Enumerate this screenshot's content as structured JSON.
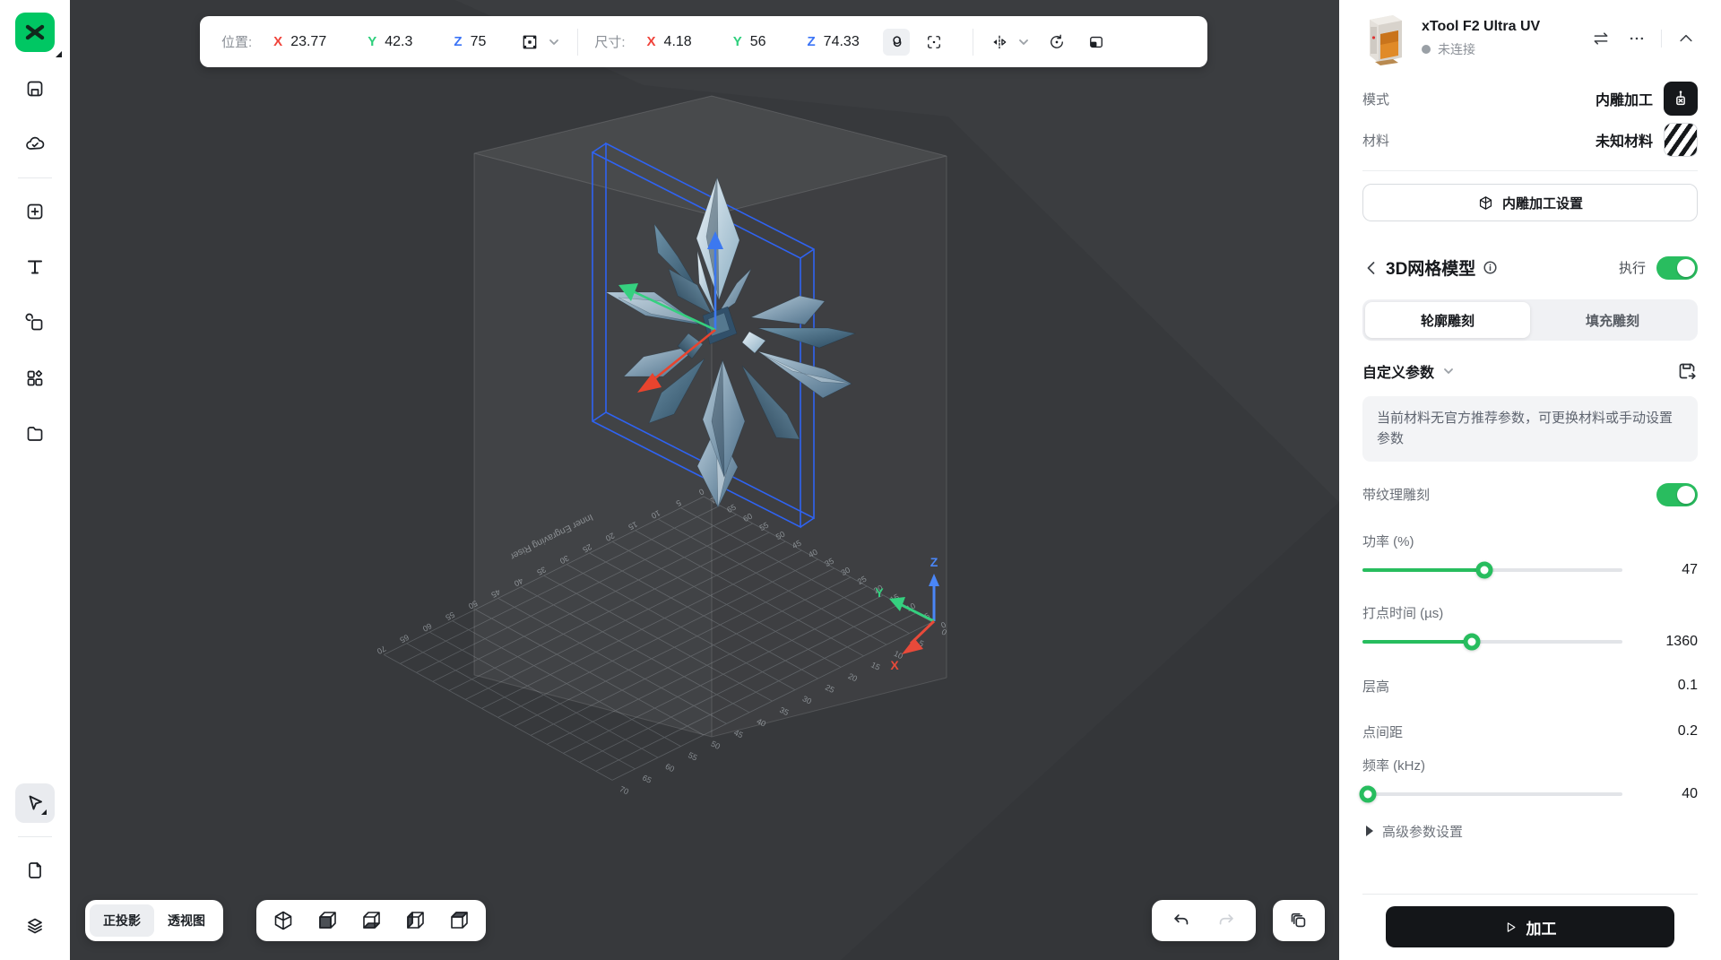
{
  "app": {
    "name": "xTool"
  },
  "sidebar": {
    "items": [
      "save",
      "cloud-sync",
      "new-project",
      "text",
      "shapes",
      "elements",
      "files"
    ],
    "bottom_items": [
      "select-tool",
      "document",
      "layers"
    ]
  },
  "toolbar": {
    "position_label": "位置:",
    "size_label": "尺寸:",
    "position": {
      "x": "23.77",
      "y": "42.3",
      "z": "75"
    },
    "size": {
      "x": "4.18",
      "y": "56",
      "z": "74.33"
    }
  },
  "viewport": {
    "projection_tabs": {
      "ortho": "正投影",
      "perspective": "透视图"
    },
    "plate": {
      "label": "Inner Engraving Riser",
      "ticks": [
        0,
        5,
        10,
        15,
        20,
        25,
        30,
        35,
        40,
        45,
        50,
        55,
        60,
        65,
        70
      ]
    },
    "gizmo": {
      "x": "X",
      "y": "Y",
      "z": "Z"
    }
  },
  "panel": {
    "device": {
      "name": "xTool F2 Ultra UV",
      "status": "未连接"
    },
    "mode": {
      "label": "模式",
      "value": "内雕加工"
    },
    "material": {
      "label": "材料",
      "value": "未知材料"
    },
    "settings_button": "内雕加工设置",
    "section": {
      "title": "3D网格模型",
      "execute_label": "执行"
    },
    "tabs": {
      "outline": "轮廓雕刻",
      "fill": "填充雕刻"
    },
    "custom_params_label": "自定义参数",
    "notice": "当前材料无官方推荐参数，可更换材料或手动设置参数",
    "texture_label": "带纹理雕刻",
    "params": [
      {
        "label": "功率 (%)",
        "value": "47"
      },
      {
        "label": "打点时间 (µs)",
        "value": "1360"
      },
      {
        "label": "层高",
        "value": "0.1"
      },
      {
        "label": "点间距",
        "value": "0.2"
      },
      {
        "label": "频率 (kHz)",
        "value": "40"
      }
    ],
    "advanced_label": "高级参数设置",
    "process_button": "加工"
  },
  "colors": {
    "accent_green": "#00c763",
    "toggle_green": "#29bd5f",
    "axis_x_red": "#f0443b",
    "axis_y_green": "#2ecf7c",
    "axis_z_blue": "#3b74f6",
    "selection_blue": "#2f63f2",
    "viewport_bg": "#37393c"
  }
}
